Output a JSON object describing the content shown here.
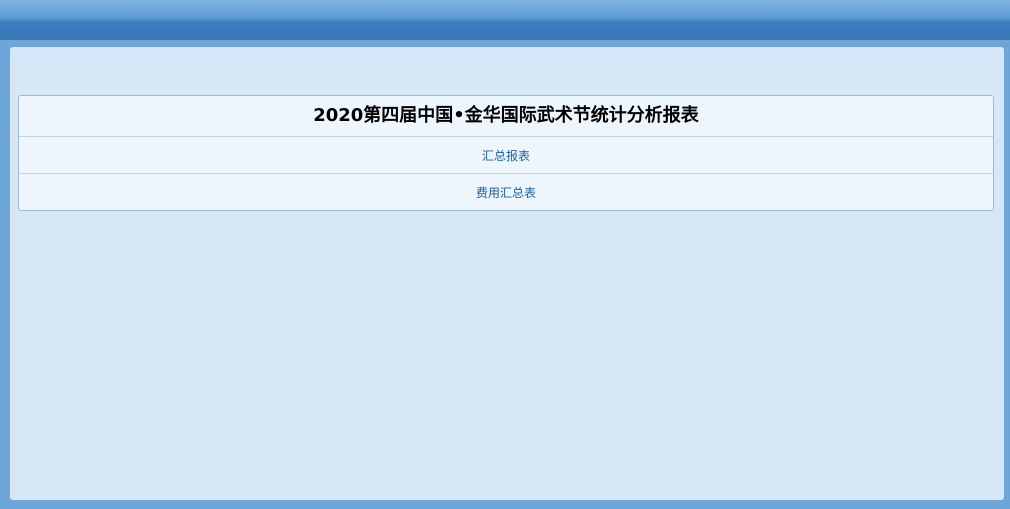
{
  "report": {
    "title": "2020第四届中国•金华国际武术节统计分析报表",
    "links": [
      {
        "label": "汇总报表"
      },
      {
        "label": "费用汇总表"
      }
    ]
  },
  "colors": {
    "header": "#3a78b8",
    "content_bg": "#d6e8f7",
    "table_bg": "#eef6fd",
    "link": "#1a5fa8"
  }
}
